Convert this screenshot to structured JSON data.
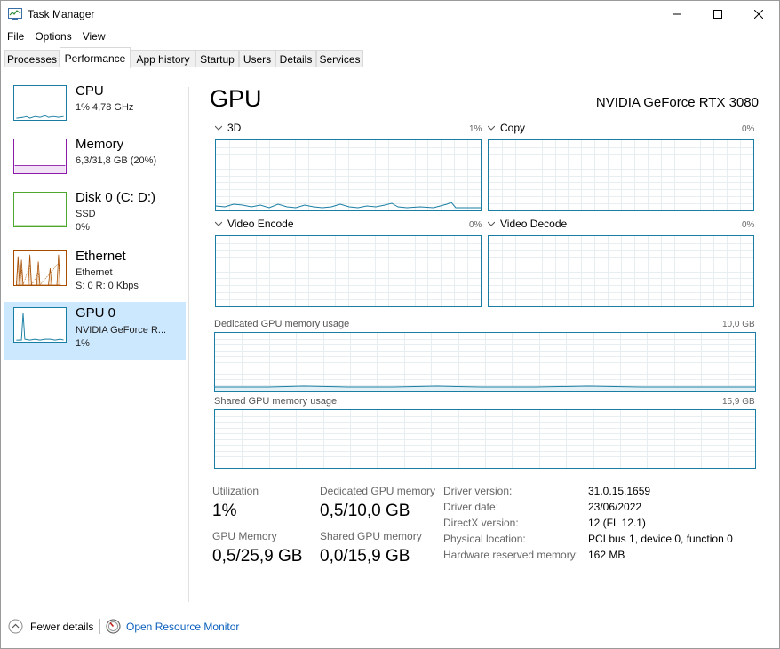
{
  "window": {
    "title": "Task Manager",
    "icon": "task-manager-icon"
  },
  "menu": [
    "File",
    "Options",
    "View"
  ],
  "tabs": [
    {
      "label": "Processes",
      "active": false
    },
    {
      "label": "Performance",
      "active": true
    },
    {
      "label": "App history",
      "active": false
    },
    {
      "label": "Startup",
      "active": false
    },
    {
      "label": "Users",
      "active": false
    },
    {
      "label": "Details",
      "active": false
    },
    {
      "label": "Services",
      "active": false
    }
  ],
  "sidebar": {
    "items": [
      {
        "title": "CPU",
        "line1": "1% 4,78 GHz",
        "line2": "",
        "color": "#1a7ea4"
      },
      {
        "title": "Memory",
        "line1": "6,3/31,8 GB (20%)",
        "line2": "",
        "color": "#8b1aa8"
      },
      {
        "title": "Disk 0 (C: D:)",
        "line1": "SSD",
        "line2": "0%",
        "color": "#4ea72e"
      },
      {
        "title": "Ethernet",
        "line1": "Ethernet",
        "line2": "S: 0 R: 0 Kbps",
        "color": "#a74f01"
      },
      {
        "title": "GPU 0",
        "line1": "NVIDIA GeForce R...",
        "line2": "1%",
        "color": "#1a7ea4",
        "selected": true
      }
    ]
  },
  "main": {
    "title": "GPU",
    "gpu_name": "NVIDIA GeForce RTX 3080",
    "engines": [
      {
        "label": "3D",
        "pct": "1%"
      },
      {
        "label": "Copy",
        "pct": "0%"
      },
      {
        "label": "Video Encode",
        "pct": "0%"
      },
      {
        "label": "Video Decode",
        "pct": "0%"
      }
    ],
    "dedicated_memory": {
      "label": "Dedicated GPU memory usage",
      "max": "10,0 GB"
    },
    "shared_memory": {
      "label": "Shared GPU memory usage",
      "max": "15,9 GB"
    },
    "stats": {
      "utilization_label": "Utilization",
      "utilization_value": "1%",
      "dedicated_label": "Dedicated GPU memory",
      "dedicated_value": "0,5/10,0 GB",
      "gpu_memory_label": "GPU Memory",
      "gpu_memory_value": "0,5/25,9 GB",
      "shared_label": "Shared GPU memory",
      "shared_value": "0,0/15,9 GB"
    },
    "info": [
      {
        "key": "Driver version:",
        "value": "31.0.15.1659"
      },
      {
        "key": "Driver date:",
        "value": "23/06/2022"
      },
      {
        "key": "DirectX version:",
        "value": "12 (FL 12.1)"
      },
      {
        "key": "Physical location:",
        "value": "PCI bus 1, device 0, function 0"
      },
      {
        "key": "Hardware reserved memory:",
        "value": "162 MB"
      }
    ]
  },
  "footer": {
    "fewer_details": "Fewer details",
    "open_resource_monitor": "Open Resource Monitor"
  },
  "colors": {
    "accent": "#1a7ea4",
    "selected_bg": "#cce8ff",
    "link": "#0a5ebd"
  }
}
